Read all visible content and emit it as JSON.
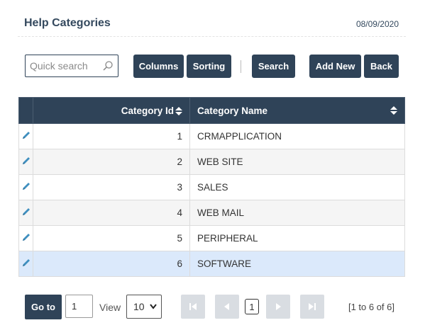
{
  "header": {
    "title": "Help Categories",
    "date": "08/09/2020"
  },
  "toolbar": {
    "search_placeholder": "Quick search",
    "columns_label": "Columns",
    "sorting_label": "Sorting",
    "search_label": "Search",
    "add_new_label": "Add New",
    "back_label": "Back"
  },
  "table": {
    "columns": [
      "Category Id",
      "Category Name"
    ],
    "rows": [
      {
        "id": "1",
        "name": "CRMAPPLICATION"
      },
      {
        "id": "2",
        "name": "WEB SITE"
      },
      {
        "id": "3",
        "name": "SALES"
      },
      {
        "id": "4",
        "name": "WEB MAIL"
      },
      {
        "id": "5",
        "name": "PERIPHERAL"
      },
      {
        "id": "6",
        "name": "SOFTWARE"
      }
    ]
  },
  "pager": {
    "goto_label": "Go to",
    "goto_value": "1",
    "view_label": "View",
    "page_size": "10",
    "current_page": "1",
    "info": "[1 to 6 of 6]"
  },
  "colors": {
    "primary": "#2f4358",
    "selected_row": "#dbe9fb",
    "edit_icon": "#3f8fbf"
  }
}
